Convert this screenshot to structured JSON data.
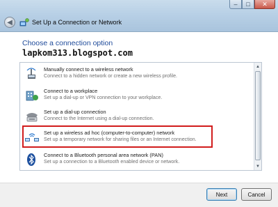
{
  "window": {
    "title": "Set Up a Connection or Network",
    "controls": {
      "minimize": "–",
      "maximize": "□",
      "close": "✕"
    }
  },
  "heading": "Choose a connection option",
  "watermark": "lapkom313.blogspot.com",
  "options": [
    {
      "title": "Manually connect to a wireless network",
      "desc": "Connect to a hidden network or create a new wireless profile.",
      "icon": "wireless-network-icon"
    },
    {
      "title": "Connect to a workplace",
      "desc": "Set up a dial-up or VPN connection to your workplace.",
      "icon": "workplace-icon"
    },
    {
      "title": "Set up a dial-up connection",
      "desc": "Connect to the Internet using a dial-up connection.",
      "icon": "dialup-modem-icon"
    },
    {
      "title": "Set up a wireless ad hoc (computer-to-computer) network",
      "desc": "Set up a temporary network for sharing files or an Internet connection.",
      "icon": "adhoc-network-icon"
    },
    {
      "title": "Connect to a Bluetooth personal area network (PAN)",
      "desc": "Set up a connection to a Bluetooth enabled device or network.",
      "icon": "bluetooth-icon"
    }
  ],
  "buttons": {
    "next": "Next",
    "cancel": "Cancel"
  },
  "colors": {
    "heading": "#1e4a9a",
    "highlight_border": "#d11c1c"
  }
}
